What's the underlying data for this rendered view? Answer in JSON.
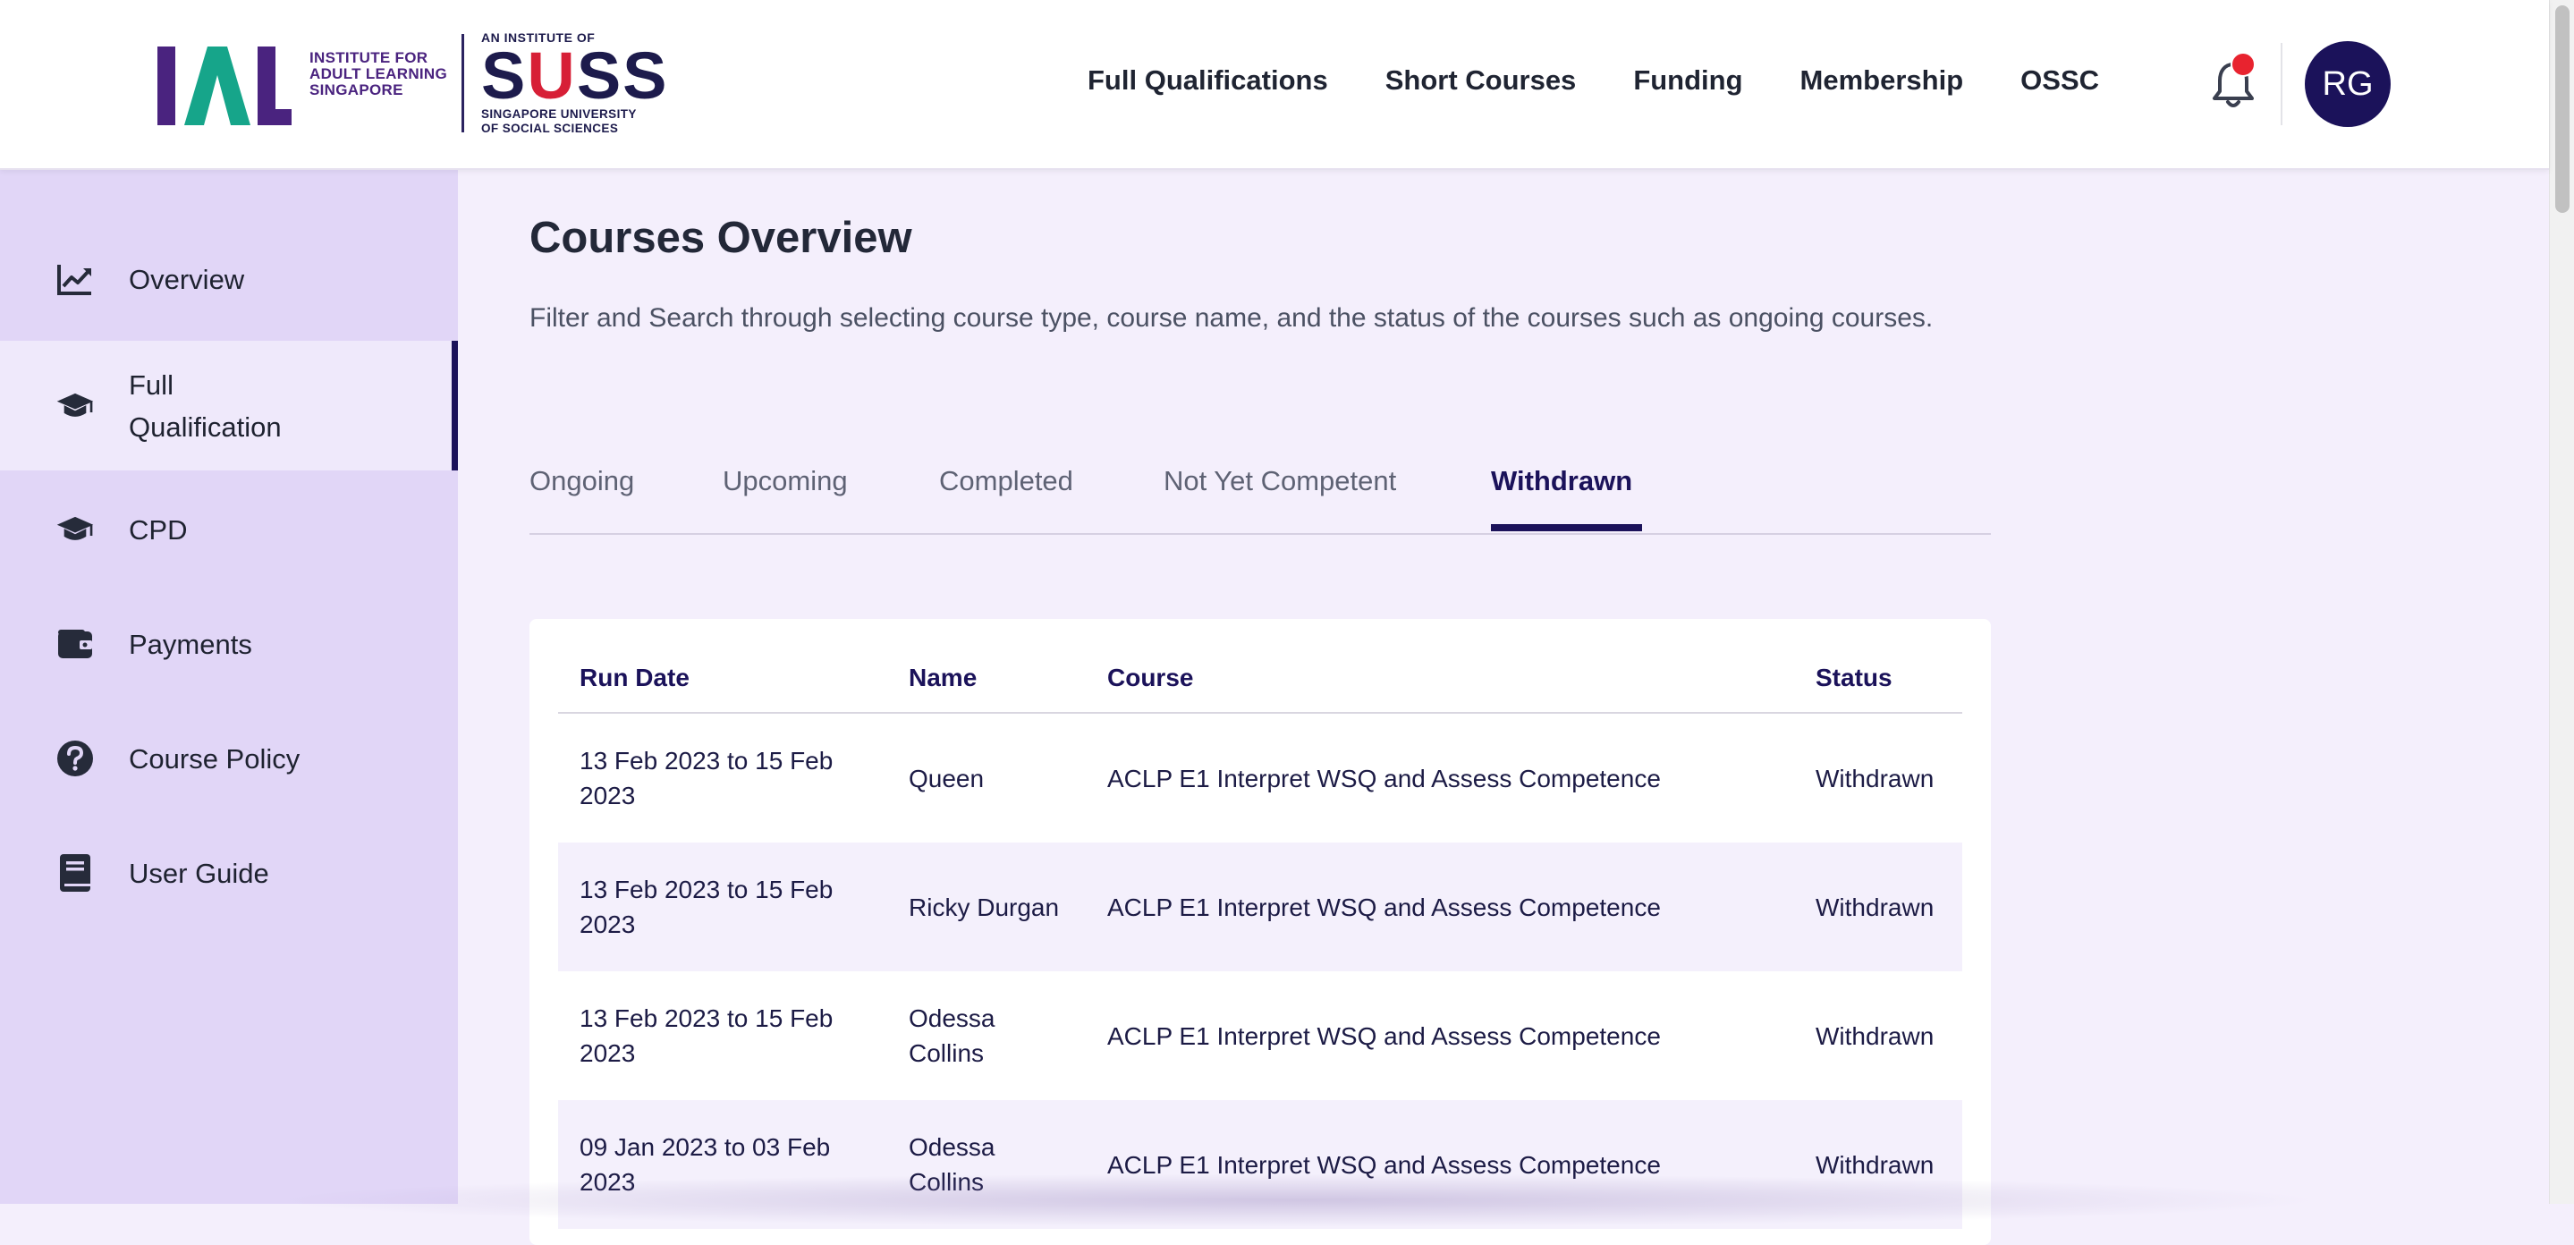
{
  "header": {
    "logo": {
      "ial_mark": "IAL",
      "ial_text": "INSTITUTE FOR ADULT LEARNING SINGAPORE",
      "suss_institute": "AN INSTITUTE OF",
      "suss_word": "SUSS",
      "suss_sub_line1": "SINGAPORE UNIVERSITY",
      "suss_sub_line2": "OF SOCIAL SCIENCES"
    },
    "nav": [
      {
        "label": "Full Qualifications"
      },
      {
        "label": "Short Courses"
      },
      {
        "label": "Funding"
      },
      {
        "label": "Membership"
      },
      {
        "label": "OSSC"
      }
    ],
    "notification_icon": "bell-icon",
    "has_notification": true,
    "avatar_initials": "RG"
  },
  "sidebar": {
    "items": [
      {
        "label": "Overview",
        "icon": "trend-chart-icon",
        "active": false
      },
      {
        "label": "Full\nQualification",
        "icon": "graduation-cap-icon",
        "active": true
      },
      {
        "label": "CPD",
        "icon": "graduation-cap-icon",
        "active": false
      },
      {
        "label": "Payments",
        "icon": "wallet-icon",
        "active": false
      },
      {
        "label": "Course Policy",
        "icon": "help-circle-icon",
        "active": false
      },
      {
        "label": "User Guide",
        "icon": "book-icon",
        "active": false
      }
    ]
  },
  "main": {
    "title": "Courses Overview",
    "description": "Filter and Search through selecting course type, course name, and the status of the courses such as ongoing courses.",
    "tabs": [
      {
        "label": "Ongoing",
        "active": false
      },
      {
        "label": "Upcoming",
        "active": false
      },
      {
        "label": "Completed",
        "active": false
      },
      {
        "label": "Not Yet Competent",
        "active": false
      },
      {
        "label": "Withdrawn",
        "active": true
      }
    ],
    "table": {
      "columns": [
        "Run Date",
        "Name",
        "Course",
        "Status"
      ],
      "rows": [
        {
          "run_date": "13 Feb 2023 to 15 Feb 2023",
          "name": "Queen",
          "course": "ACLP E1 Interpret WSQ and Assess Competence",
          "status": "Withdrawn"
        },
        {
          "run_date": "13 Feb 2023 to 15 Feb 2023",
          "name": "Ricky Durgan",
          "course": "ACLP E1 Interpret WSQ and Assess Competence",
          "status": "Withdrawn"
        },
        {
          "run_date": "13 Feb 2023 to 15 Feb 2023",
          "name": "Odessa Collins",
          "course": "ACLP E1 Interpret WSQ and Assess Competence",
          "status": "Withdrawn"
        },
        {
          "run_date": "09 Jan 2023 to 03 Feb 2023",
          "name": "Odessa Collins",
          "course": "ACLP E1 Interpret WSQ and Assess Competence",
          "status": "Withdrawn"
        }
      ]
    }
  },
  "colors": {
    "brand_navy": "#1b125a",
    "sidebar_bg": "#e1d6f7",
    "page_bg": "#f4effc",
    "notification_red": "#e8232f",
    "suss_red": "#d71f36",
    "ial_purple": "#4a237f"
  }
}
